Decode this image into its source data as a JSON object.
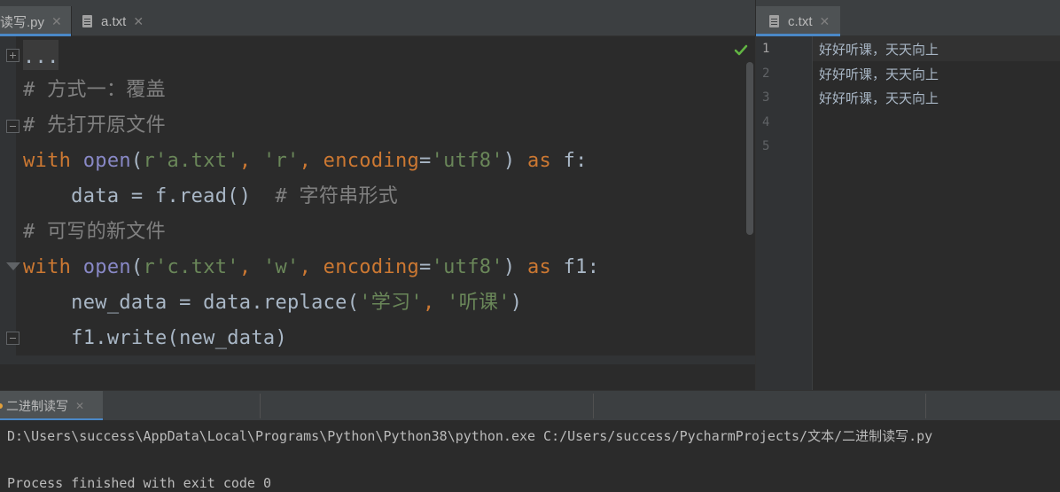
{
  "editor_tabs": {
    "left": [
      {
        "label": "读写.py",
        "icon": "python-file-icon"
      },
      {
        "label": "a.txt",
        "icon": "text-file-icon"
      }
    ],
    "right": [
      {
        "label": "c.txt",
        "icon": "text-file-icon"
      }
    ]
  },
  "code": {
    "line0": "...",
    "line1": "# 方式一：覆盖",
    "line2": "# 先打开原文件",
    "line3": {
      "t1": "with",
      "t2": " ",
      "t3": "open",
      "t4": "(",
      "t5": "r'a.txt'",
      "t6": ", ",
      "t7": "'r'",
      "t8": ", ",
      "t9": "encoding",
      "t10": "=",
      "t11": "'utf8'",
      "t12": ") ",
      "t13": "as",
      "t14": " f:"
    },
    "line4": {
      "t1": "    data = f.read()  ",
      "t2": "# 字符串形式"
    },
    "line5": "# 可写的新文件",
    "line6": {
      "t1": "with",
      "t2": " ",
      "t3": "open",
      "t4": "(",
      "t5": "r'c.txt'",
      "t6": ", ",
      "t7": "'w'",
      "t8": ", ",
      "t9": "encoding",
      "t10": "=",
      "t11": "'utf8'",
      "t12": ") ",
      "t13": "as",
      "t14": " f1:"
    },
    "line7": {
      "t1": "    new_data = data.replace(",
      "t2": "'学习'",
      "t3": ", ",
      "t4": "'听课'",
      "t5": ")"
    },
    "line8": "    f1.write(new_data)"
  },
  "right_file": {
    "line_numbers": [
      "1",
      "2",
      "3",
      "4",
      "5"
    ],
    "lines": [
      "好好听课，天天向上",
      "好好听课，天天向上",
      "好好听课，天天向上"
    ]
  },
  "run": {
    "tab_label": "二进制读写",
    "command": "D:\\Users\\success\\AppData\\Local\\Programs\\Python\\Python38\\python.exe C:/Users/success/PycharmProjects/文本/二进制读写.py",
    "exit_message": "Process finished with exit code 0"
  },
  "colors": {
    "keyword": "#cc7832",
    "builtin": "#8888c6",
    "string": "#6a8759",
    "comment": "#808080",
    "accent": "#4a88c7",
    "check": "#62b543"
  }
}
